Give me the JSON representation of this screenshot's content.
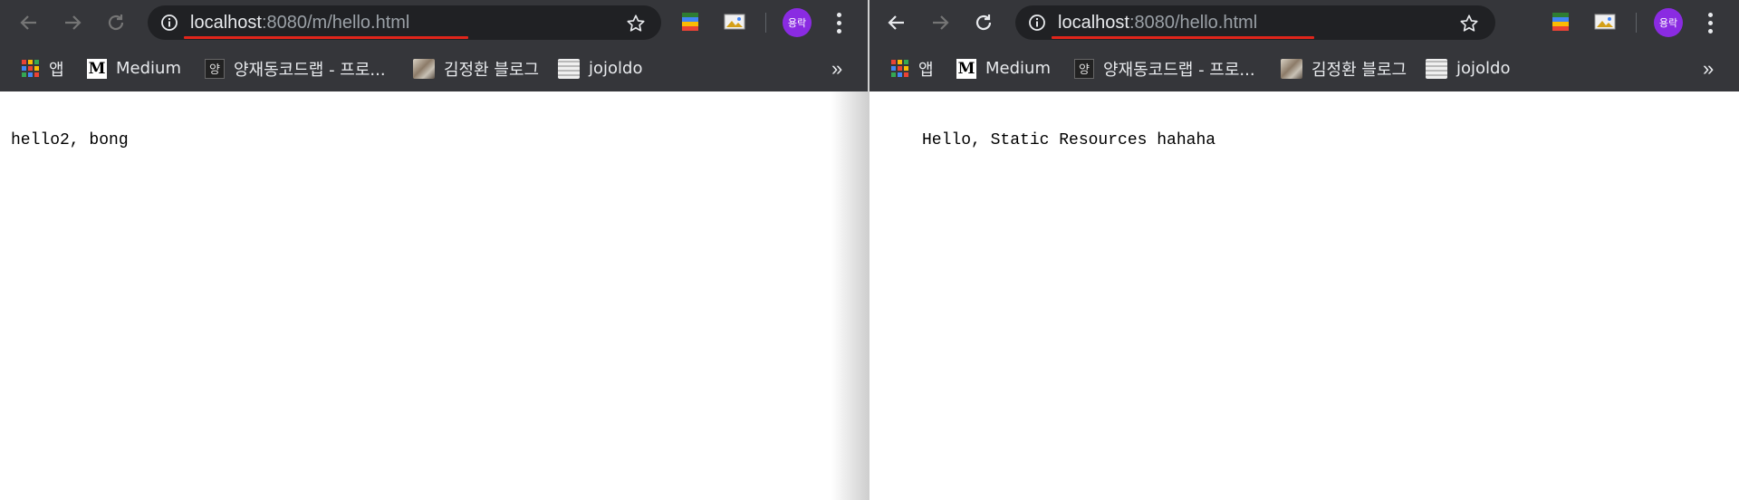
{
  "windows": [
    {
      "url": {
        "host": "localhost",
        "rest": ":8080/m/hello.html"
      },
      "bookmarks": [
        {
          "label": "앱",
          "icon": "apps-grid-icon"
        },
        {
          "label": "Medium",
          "icon": "medium-logo-icon"
        },
        {
          "label": "양재동코드랩 - 프로...",
          "icon": "yangjae-favicon-icon"
        },
        {
          "label": "김정환 블로그",
          "icon": "blog-photo-icon"
        },
        {
          "label": "jojoldo",
          "icon": "jojoldo-photo-icon"
        }
      ],
      "overflow_chevron": "»",
      "avatar_text": "용락",
      "page_text": "hello2, bong"
    },
    {
      "url": {
        "host": "localhost",
        "rest": ":8080/hello.html"
      },
      "bookmarks": [
        {
          "label": "앱",
          "icon": "apps-grid-icon"
        },
        {
          "label": "Medium",
          "icon": "medium-logo-icon"
        },
        {
          "label": "양재동코드랩 - 프로...",
          "icon": "yangjae-favicon-icon"
        },
        {
          "label": "김정환 블로그",
          "icon": "blog-photo-icon"
        },
        {
          "label": "jojoldo",
          "icon": "jojoldo-photo-icon"
        }
      ],
      "overflow_chevron": "»",
      "avatar_text": "용락",
      "page_text": "Hello, Static Resources hahaha"
    }
  ],
  "colors": {
    "toolbar_bg": "#35363a",
    "omnibox_bg": "#202124",
    "url_highlight": "#e0251b",
    "avatar": "#8a2be2"
  }
}
